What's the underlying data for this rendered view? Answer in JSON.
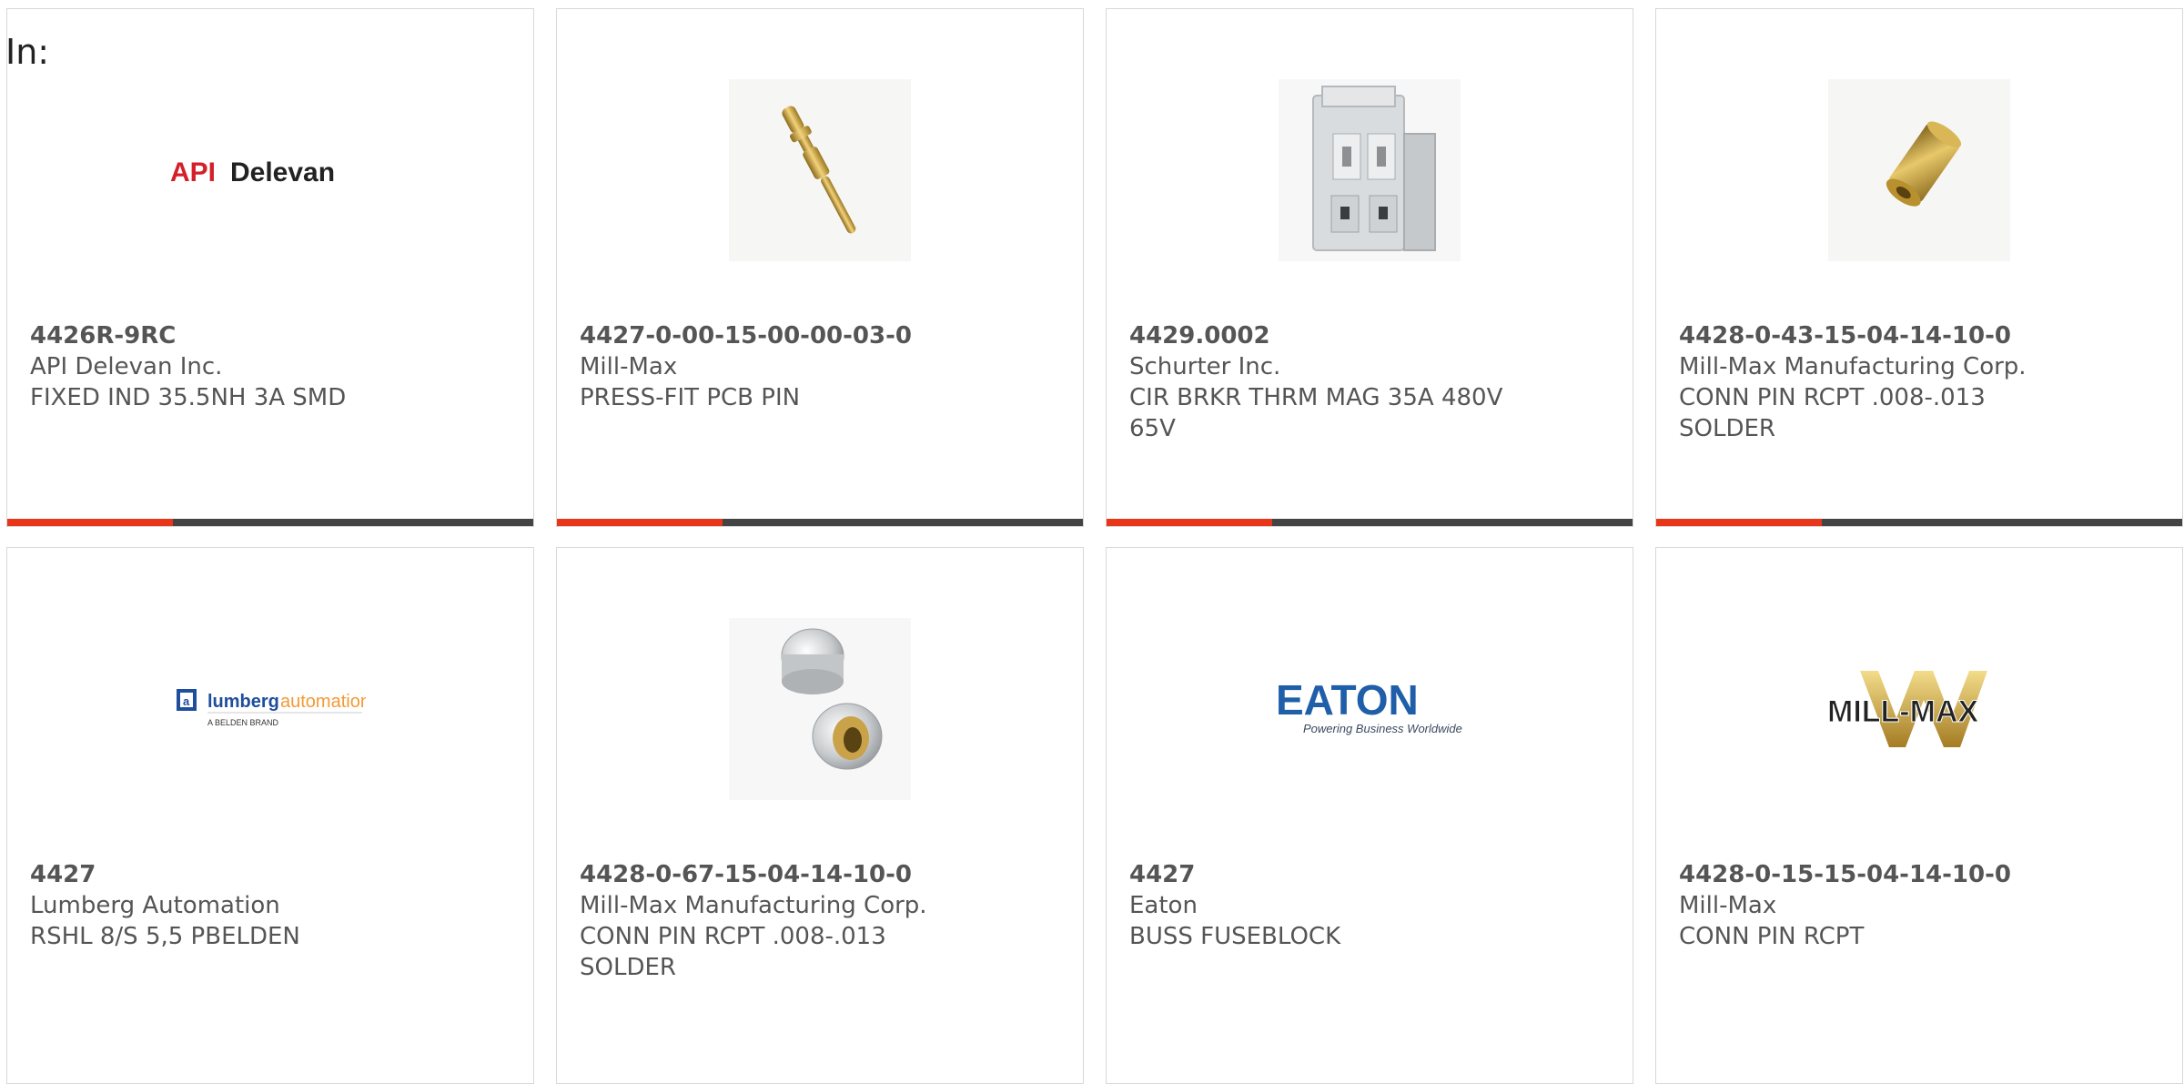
{
  "filter": {
    "label": "In:"
  },
  "colors": {
    "accent": "#e8361a",
    "bar": "#444444",
    "text": "#555555",
    "border": "#d8d8d8"
  },
  "products": [
    {
      "part_number": "4426R-9RC",
      "manufacturer": "API Delevan Inc.",
      "description": "FIXED IND 35.5NH 3A SMD",
      "image": "api-delevan-logo",
      "logo_text_a": "API",
      "logo_text_b": "Delevan"
    },
    {
      "part_number": "4427-0-00-15-00-00-03-0",
      "manufacturer": "Mill-Max",
      "description": "PRESS-FIT PCB PIN",
      "image": "press-fit-pin-photo"
    },
    {
      "part_number": "4429.0002",
      "manufacturer": "Schurter Inc.",
      "description": "CIR BRKR THRM MAG 35A 480V 65V",
      "image": "circuit-breaker-photo"
    },
    {
      "part_number": "4428-0-43-15-04-14-10-0",
      "manufacturer": "Mill-Max Manufacturing Corp.",
      "description": "CONN PIN RCPT .008-.013 SOLDER",
      "image": "brass-receptacle-photo"
    },
    {
      "part_number": "4427",
      "manufacturer": "Lumberg Automation",
      "description": "RSHL 8/S 5,5 PBELDEN",
      "image": "lumberg-automation-logo",
      "logo_text_a": "lumberg",
      "logo_text_b": "automation",
      "logo_text_c": "A BELDEN BRAND"
    },
    {
      "part_number": "4428-0-67-15-04-14-10-0",
      "manufacturer": "Mill-Max Manufacturing Corp.",
      "description": "CONN PIN RCPT .008-.013 SOLDER",
      "image": "receptacle-sockets-photo"
    },
    {
      "part_number": "4427",
      "manufacturer": "Eaton",
      "description": "BUSS FUSEBLOCK",
      "image": "eaton-logo",
      "logo_text_a": "EATON",
      "logo_text_b": "Powering Business Worldwide"
    },
    {
      "part_number": "4428-0-15-15-04-14-10-0",
      "manufacturer": "Mill-Max",
      "description": "CONN PIN RCPT",
      "image": "mill-max-logo",
      "logo_text_a": "MILL-MAX"
    }
  ]
}
